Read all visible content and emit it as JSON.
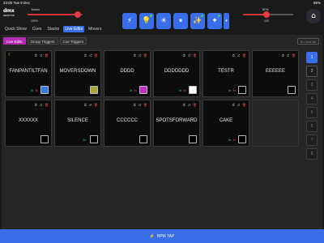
{
  "status": {
    "time": "23:00",
    "date": "Tue 9 Dec",
    "battery": "86%"
  },
  "app": {
    "logo_line1": "dmx",
    "logo_line2": "DESKTOP"
  },
  "master": {
    "label": "Master",
    "value": "100%",
    "level": 1.0
  },
  "bpm": {
    "label": "BPM",
    "value": "120",
    "level": 0.5
  },
  "toolbar": {
    "buttons": [
      {
        "icon": "lightning-icon",
        "glyph": "⚡"
      },
      {
        "icon": "lightbulb-icon",
        "glyph": "💡"
      },
      {
        "icon": "sun-icon",
        "glyph": "☀"
      },
      {
        "icon": "pause-icon",
        "glyph": "⏸"
      },
      {
        "icon": "magic-wand-icon",
        "glyph": "✨"
      },
      {
        "icon": "sparkle-icon",
        "glyph": "✦"
      }
    ],
    "more_glyph": "▾"
  },
  "main_tabs": [
    "Quick Show",
    "Cues",
    "Stacks",
    "Live Edits",
    "Movers"
  ],
  "active_main_tab": "Live Edits",
  "sub_tabs": [
    "Live Edits",
    "Group Triggers",
    "Cue Triggers"
  ],
  "active_sub_tab": "Live Edits",
  "clear_all": "⊗ Clear All",
  "cells": [
    {
      "name": "FANPANTILTFAN",
      "count_green": "2s",
      "count_red": "3s",
      "swatch": "#2f7de0"
    },
    {
      "name": "MOVERSDOWN",
      "count_green": "",
      "count_red": "",
      "swatch": "#a8a838"
    },
    {
      "name": "DDDD",
      "count_green": "2s",
      "count_red": "3s",
      "swatch": "#c32cc9"
    },
    {
      "name": "DDDDDDD",
      "count_green": "2s",
      "count_red": "3s",
      "swatch": "#ffffff"
    },
    {
      "name": "TESTR",
      "count_green": "2s",
      "count_red": "3s",
      "swatch": "#000000"
    },
    {
      "name": "EEEEEE",
      "count_green": "",
      "count_red": "",
      "swatch": "#000000"
    },
    {
      "name": "XXXXXX",
      "count_green": "",
      "count_red": "",
      "swatch": "#000000"
    },
    {
      "name": "SILENCE",
      "count_green": "2s",
      "count_red": "",
      "swatch": "#000000"
    },
    {
      "name": "CCCCCC",
      "count_green": "",
      "count_red": "",
      "swatch": "#000000"
    },
    {
      "name": "SPOTSFORWARD",
      "count_green": "",
      "count_red": "",
      "swatch": "#000000"
    },
    {
      "name": "CAKE",
      "count_green": "2s",
      "count_red": "3s",
      "swatch": "#000000"
    }
  ],
  "pages": [
    "1",
    "2",
    "3",
    "4",
    "5",
    "6",
    "7",
    "8"
  ],
  "active_page": "1",
  "bottom": {
    "label": "BPM TAP",
    "glyph": "⚡"
  }
}
